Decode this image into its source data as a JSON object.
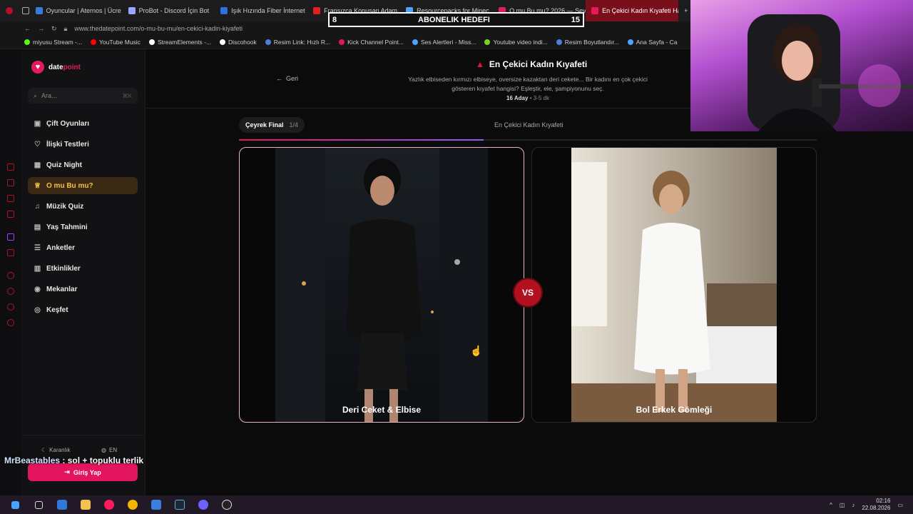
{
  "browser": {
    "tabs": [
      {
        "label": "Oyuncular | Aternos | Ücre",
        "color": "#3b7bd8"
      },
      {
        "label": "ProBot - Discord İçin Bot",
        "color": "#9aa6ff"
      },
      {
        "label": "Işık Hızında Fiber İnternet",
        "color": "#2f6ee0"
      },
      {
        "label": "Fransızca Konuşan Adam",
        "color": "#e32020"
      },
      {
        "label": "Resourcepacks for Minec",
        "color": "#4aa3ff"
      },
      {
        "label": "O mu Bu mu? 2026 — Sev",
        "color": "#e31b5a"
      },
      {
        "label": "En Çekici Kadın Kıyafeti Ha",
        "color": "#e31b5a"
      }
    ],
    "url": "www.thedatepoint.com/o-mu-bu-mu/en-cekici-kadin-kiyafeti",
    "bookmarks": [
      {
        "label": "miyusu Stream -...",
        "color": "#53fc18"
      },
      {
        "label": "YouTube Music",
        "color": "#ff0000"
      },
      {
        "label": "StreamElements -...",
        "color": "#ffffff"
      },
      {
        "label": "Discohook",
        "color": "#ffffff"
      },
      {
        "label": "Resim Link: Hızlı R...",
        "color": "#4a7fd8"
      },
      {
        "label": "Kick Channel Point...",
        "color": "#e3155f"
      },
      {
        "label": "Ses Alertleri - Miss...",
        "color": "#4aa3ff"
      },
      {
        "label": "Youtube video indi...",
        "color": "#7ed321"
      },
      {
        "label": "Resim Boyutlandır...",
        "color": "#4a7fd8"
      },
      {
        "label": "Ana Sayfa - Ca",
        "color": "#4aa3ff"
      }
    ]
  },
  "goal_overlay": {
    "current": "8",
    "label": "ABONELIK HEDEFI",
    "target": "15"
  },
  "sidebar": {
    "logo_part1": "date",
    "logo_part2": "point",
    "search_placeholder": "Ara...",
    "search_shortcut": "⌘K",
    "items": [
      {
        "label": "Çift Oyunları",
        "icon": "gamepad-icon",
        "glyph": "▣"
      },
      {
        "label": "İlişki Testleri",
        "icon": "heart-icon",
        "glyph": "♡"
      },
      {
        "label": "Quiz Night",
        "icon": "grid-icon",
        "glyph": "▦"
      },
      {
        "label": "O mu Bu mu?",
        "icon": "trophy-icon",
        "glyph": "♕"
      },
      {
        "label": "Müzik Quiz",
        "icon": "headphones-icon",
        "glyph": "♫"
      },
      {
        "label": "Yaş Tahmini",
        "icon": "calendar-icon",
        "glyph": "▤"
      },
      {
        "label": "Anketler",
        "icon": "list-icon",
        "glyph": "☰"
      },
      {
        "label": "Etkinlikler",
        "icon": "event-icon",
        "glyph": "▥"
      },
      {
        "label": "Mekanlar",
        "icon": "location-icon",
        "glyph": "◉"
      },
      {
        "label": "Keşfet",
        "icon": "compass-icon",
        "glyph": "◎"
      }
    ],
    "theme_label": "Karanlık",
    "lang_label": "EN",
    "login_label": "Giriş Yap"
  },
  "chat": {
    "user": "MrBeastables",
    "message": ": sol + topuklu terlik"
  },
  "page": {
    "back_label": "Geri",
    "title": "En Çekici Kadın Kıyafeti",
    "description": "Yazlık elbiseden kırmızı elbiseye, oversize kazaktan deri cekete... Bir kadını en çok çekici gösteren kıyafet hangisi? Eşleştir, ele, şampiyonunu seç.",
    "candidates": "16 Aday",
    "duration": "3-5 dk",
    "round_label": "Çeyrek Final",
    "round_fraction": "1/4",
    "subtitle": "En Çekici Kadın Kıyafeti",
    "progress": 0.53,
    "left_caption": "Deri Ceket & Elbise",
    "right_caption": "Bol Erkek Gömleği",
    "vs_label": "VS"
  },
  "taskbar": {
    "time": "02:16",
    "date": "22.08.2026"
  }
}
